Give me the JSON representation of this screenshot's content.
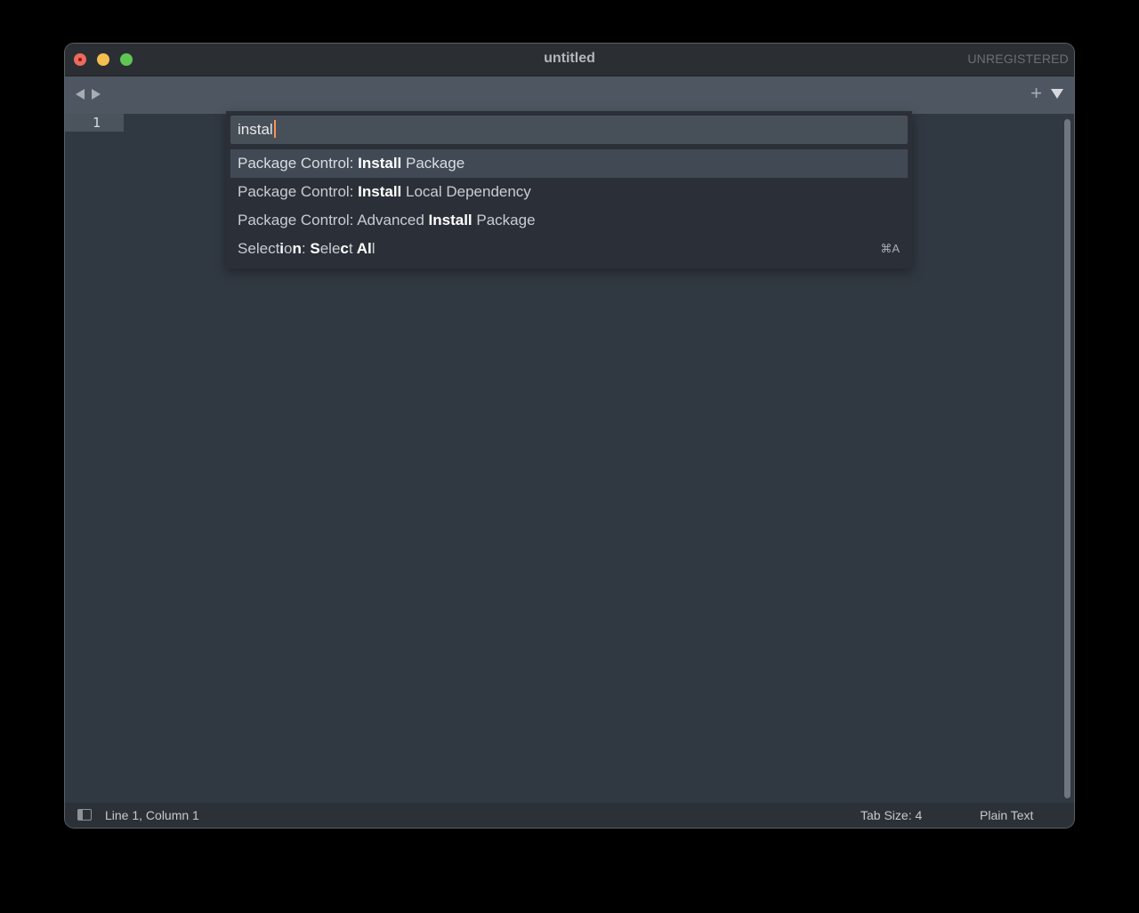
{
  "window": {
    "title": "untitled",
    "license_status": "UNREGISTERED"
  },
  "tabbar": {
    "back_icon": "chevron-left-icon",
    "forward_icon": "chevron-right-icon",
    "new_tab_label": "+",
    "tab_list_icon": "triangle-down-icon"
  },
  "editor": {
    "line_numbers": [
      "1"
    ]
  },
  "command_palette": {
    "query": "instal",
    "items": [
      {
        "prefix": "Package Control: ",
        "match": "Install",
        "suffix": " Package",
        "shortcut": "",
        "selected": true
      },
      {
        "prefix": "Package Control: ",
        "match": "Install",
        "suffix": " Local Dependency",
        "shortcut": ""
      },
      {
        "prefix": "Package Control: Advanced ",
        "match": "Install",
        "suffix": " Package",
        "shortcut": ""
      },
      {
        "prefix": "Selection: Select All",
        "match": "",
        "suffix": "",
        "shortcut": "⌘A"
      }
    ]
  },
  "statusbar": {
    "position": "Line 1, Column 1",
    "tab_size": "Tab Size: 4",
    "syntax": "Plain Text"
  },
  "colors": {
    "background": "#303841",
    "caret": "#f99157",
    "palette": "#2b3038",
    "selected_item": "#414a54"
  }
}
